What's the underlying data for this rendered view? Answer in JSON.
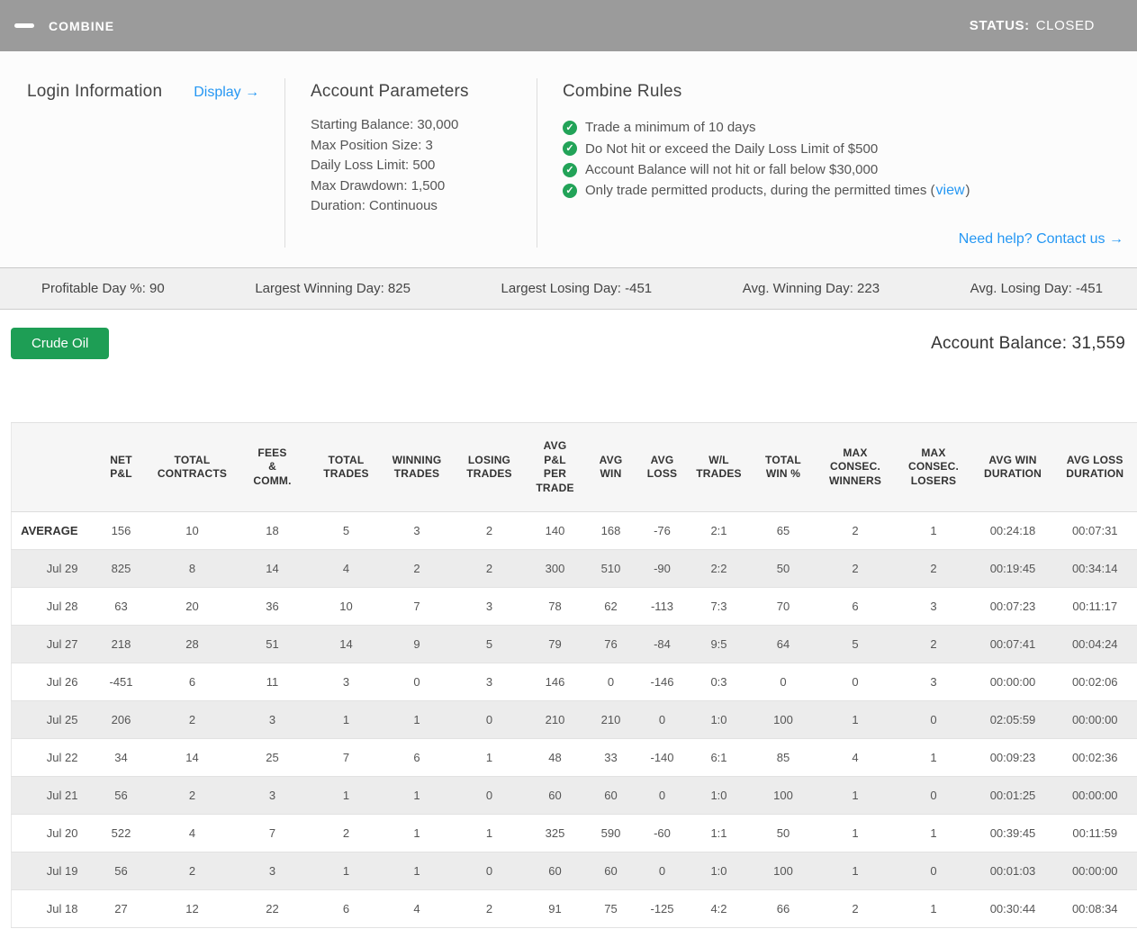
{
  "header": {
    "title": "COMBINE",
    "status_label": "STATUS:",
    "status_value": "CLOSED"
  },
  "icons": {
    "collapse_icon": "minus-bar",
    "check_icon": "✓",
    "arrow_right": "→"
  },
  "colors": {
    "topbar_gray": "#9b9b9b",
    "link_blue": "#2597f3",
    "check_green": "#22a358",
    "button_green": "#1e9e55",
    "stripe_gray": "#ececec"
  },
  "info": {
    "login": {
      "title": "Login Information",
      "display_link": "Display →"
    },
    "parameters": {
      "title": "Account Parameters",
      "items": [
        {
          "label": "Starting Balance",
          "value": "30,000"
        },
        {
          "label": "Max Position Size",
          "value": "3"
        },
        {
          "label": "Daily Loss Limit",
          "value": "500"
        },
        {
          "label": "Max Drawdown",
          "value": "1,500"
        },
        {
          "label": "Duration",
          "value": "Continuous"
        }
      ]
    },
    "rules": {
      "title": "Combine Rules",
      "items": [
        {
          "text": "Trade a minimum of 10 days"
        },
        {
          "text": "Do Not hit or exceed the Daily Loss Limit of $500"
        },
        {
          "text": "Account Balance will not hit or fall below $30,000"
        },
        {
          "text": "Only trade permitted products, during the permitted times (",
          "link": "view",
          "after": ")"
        }
      ],
      "help_link": "Need help? Contact us →"
    }
  },
  "stats": [
    {
      "label": "Profitable Day %",
      "value": "90"
    },
    {
      "label": "Largest Winning Day",
      "value": "825"
    },
    {
      "label": "Largest Losing Day",
      "value": "-451"
    },
    {
      "label": "Avg. Winning Day",
      "value": "223"
    },
    {
      "label": "Avg. Losing Day",
      "value": "-451"
    }
  ],
  "account": {
    "product_button": "Crude Oil",
    "balance_label": "Account Balance: ",
    "balance_value": "31,559"
  },
  "table": {
    "columns": [
      {
        "name": "row-label",
        "lines": []
      },
      {
        "name": "net-pl",
        "lines": [
          "NET",
          "P&L"
        ]
      },
      {
        "name": "total-contracts",
        "lines": [
          "TOTAL",
          "CONTRACTS"
        ]
      },
      {
        "name": "fees-comm",
        "lines": [
          "FEES",
          "&",
          "COMM."
        ]
      },
      {
        "name": "total-trades",
        "lines": [
          "TOTAL",
          "TRADES"
        ]
      },
      {
        "name": "winning-trades",
        "lines": [
          "WINNING",
          "TRADES"
        ]
      },
      {
        "name": "losing-trades",
        "lines": [
          "LOSING",
          "TRADES"
        ]
      },
      {
        "name": "avg-pl-per-trade",
        "lines": [
          "AVG",
          "P&L",
          "PER",
          "TRADE"
        ]
      },
      {
        "name": "avg-win",
        "lines": [
          "AVG",
          "WIN"
        ]
      },
      {
        "name": "avg-loss",
        "lines": [
          "AVG",
          "LOSS"
        ]
      },
      {
        "name": "wl-trades",
        "lines": [
          "W/L",
          "TRADES"
        ]
      },
      {
        "name": "total-win-pct",
        "lines": [
          "TOTAL",
          "WIN %"
        ]
      },
      {
        "name": "max-consec-winners",
        "lines": [
          "MAX",
          "CONSEC.",
          "WINNERS"
        ]
      },
      {
        "name": "max-consec-losers",
        "lines": [
          "MAX",
          "CONSEC.",
          "LOSERS"
        ]
      },
      {
        "name": "avg-win-duration",
        "lines": [
          "AVG WIN",
          "DURATION"
        ]
      },
      {
        "name": "avg-loss-duration",
        "lines": [
          "AVG LOSS",
          "DURATION"
        ]
      }
    ],
    "rows": [
      {
        "label": "AVERAGE",
        "emphasis": true,
        "values": [
          "156",
          "10",
          "18",
          "5",
          "3",
          "2",
          "140",
          "168",
          "-76",
          "2:1",
          "65",
          "2",
          "1",
          "00:24:18",
          "00:07:31"
        ]
      },
      {
        "label": "Jul 29",
        "values": [
          "825",
          "8",
          "14",
          "4",
          "2",
          "2",
          "300",
          "510",
          "-90",
          "2:2",
          "50",
          "2",
          "2",
          "00:19:45",
          "00:34:14"
        ]
      },
      {
        "label": "Jul 28",
        "values": [
          "63",
          "20",
          "36",
          "10",
          "7",
          "3",
          "78",
          "62",
          "-113",
          "7:3",
          "70",
          "6",
          "3",
          "00:07:23",
          "00:11:17"
        ]
      },
      {
        "label": "Jul 27",
        "values": [
          "218",
          "28",
          "51",
          "14",
          "9",
          "5",
          "79",
          "76",
          "-84",
          "9:5",
          "64",
          "5",
          "2",
          "00:07:41",
          "00:04:24"
        ]
      },
      {
        "label": "Jul 26",
        "values": [
          "-451",
          "6",
          "11",
          "3",
          "0",
          "3",
          "146",
          "0",
          "-146",
          "0:3",
          "0",
          "0",
          "3",
          "00:00:00",
          "00:02:06"
        ]
      },
      {
        "label": "Jul 25",
        "values": [
          "206",
          "2",
          "3",
          "1",
          "1",
          "0",
          "210",
          "210",
          "0",
          "1:0",
          "100",
          "1",
          "0",
          "02:05:59",
          "00:00:00"
        ]
      },
      {
        "label": "Jul 22",
        "values": [
          "34",
          "14",
          "25",
          "7",
          "6",
          "1",
          "48",
          "33",
          "-140",
          "6:1",
          "85",
          "4",
          "1",
          "00:09:23",
          "00:02:36"
        ]
      },
      {
        "label": "Jul 21",
        "values": [
          "56",
          "2",
          "3",
          "1",
          "1",
          "0",
          "60",
          "60",
          "0",
          "1:0",
          "100",
          "1",
          "0",
          "00:01:25",
          "00:00:00"
        ]
      },
      {
        "label": "Jul 20",
        "values": [
          "522",
          "4",
          "7",
          "2",
          "1",
          "1",
          "325",
          "590",
          "-60",
          "1:1",
          "50",
          "1",
          "1",
          "00:39:45",
          "00:11:59"
        ]
      },
      {
        "label": "Jul 19",
        "values": [
          "56",
          "2",
          "3",
          "1",
          "1",
          "0",
          "60",
          "60",
          "0",
          "1:0",
          "100",
          "1",
          "0",
          "00:01:03",
          "00:00:00"
        ]
      },
      {
        "label": "Jul 18",
        "values": [
          "27",
          "12",
          "22",
          "6",
          "4",
          "2",
          "91",
          "75",
          "-125",
          "4:2",
          "66",
          "2",
          "1",
          "00:30:44",
          "00:08:34"
        ]
      }
    ]
  }
}
